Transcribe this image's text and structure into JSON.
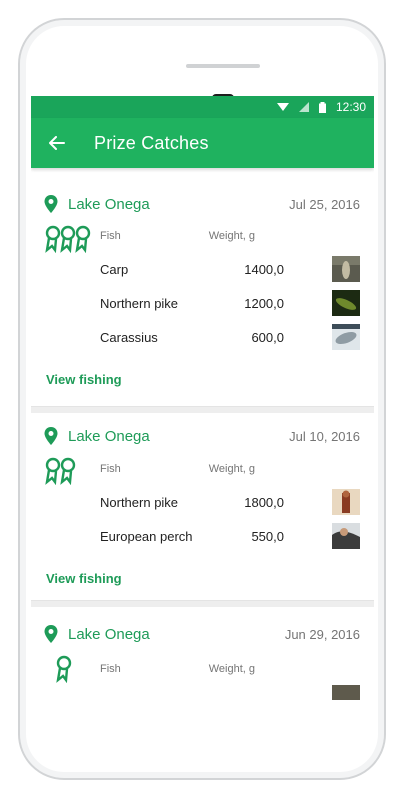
{
  "status": {
    "time": "12:30"
  },
  "toolbar": {
    "title": "Prize Catches"
  },
  "columns": {
    "fish": "Fish",
    "weight": "Weight, g"
  },
  "cards": [
    {
      "lake": "Lake Onega",
      "date": "Jul 25, 2016",
      "rows": [
        {
          "fish": "Carp",
          "weight": "1400,0"
        },
        {
          "fish": "Northern pike",
          "weight": "1200,0"
        },
        {
          "fish": "Carassius",
          "weight": "600,0"
        }
      ],
      "link": "View fishing"
    },
    {
      "lake": "Lake Onega",
      "date": "Jul 10, 2016",
      "rows": [
        {
          "fish": "Northern pike",
          "weight": "1800,0"
        },
        {
          "fish": "European perch",
          "weight": "550,0"
        }
      ],
      "link": "View fishing"
    },
    {
      "lake": "Lake Onega",
      "date": "Jun 29, 2016",
      "rows": [],
      "link": ""
    }
  ],
  "colors": {
    "primary": "#1fb25f",
    "statusbar": "#1aa55a",
    "accent": "#1e9b58"
  }
}
